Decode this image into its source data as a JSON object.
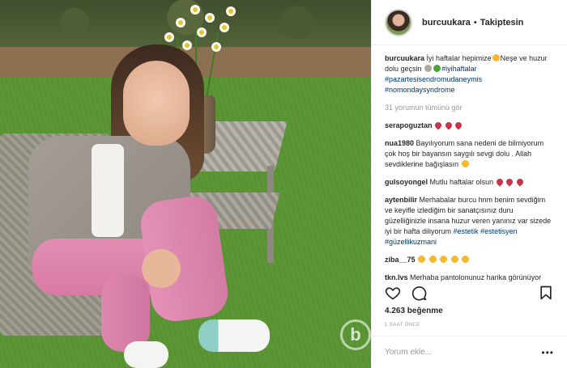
{
  "post": {
    "username": "burcuukara",
    "separator": "•",
    "follow_state": "Takiptesin",
    "caption_text": "İyi haftalar hepimize",
    "caption_text2": "Neşe ve huzur dolu geçsin",
    "caption_tag1": "#iyihaftalar",
    "caption_tag2": "#pazartesisendromudaneymis",
    "caption_tag3": "#nomondaysyndrome",
    "view_all": "31 yorumun tümünü gör",
    "likes": "4.263 beğenme",
    "timestamp": "1 SAAT ÖNCE",
    "comment_placeholder": "Yorum ekle...",
    "more_label": "•••",
    "watermark": "b"
  },
  "comments": [
    {
      "user": "serapoguztan",
      "text": ""
    },
    {
      "user": "nua1980",
      "text": "Bayılıyorum sana nedeni de bilmiyorum çok hoş bir bayansın saygılı sevgi dolu . Allah sevdiklerine bağışlasın"
    },
    {
      "user": "gulsoyongel",
      "text": "Mutlu haftalar olsun"
    },
    {
      "user": "aytenbilir",
      "text": "Merhabalar burcu hnm benim sevdiğim ve keyifle izlediğim bir sanatçısınız duru güzelliğinizle insana huzur veren yanınız var sizede iyi bir hafta diliyorum",
      "tags": "#estetik #estetisyen #güzellikuzmani"
    },
    {
      "user": "ziba__75",
      "text": ""
    },
    {
      "user": "tkn.lvs",
      "text": "Merhaba pantolonunuz harika görünüyor nerden aldınız"
    }
  ],
  "icons": {
    "like": "heart-icon",
    "comment": "comment-bubble-icon",
    "save": "bookmark-icon"
  },
  "colors": {
    "link": "#003569",
    "muted": "#999999",
    "text": "#262626"
  }
}
